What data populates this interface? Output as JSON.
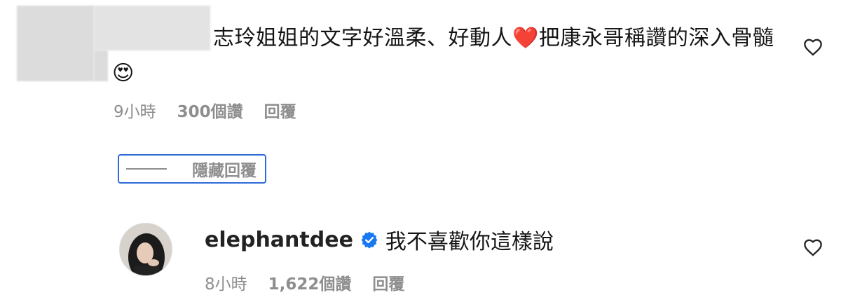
{
  "comment1": {
    "text_part1": "志玲姐姐的文字好溫柔、好動人",
    "heart_emoji": "❤️",
    "text_part2": "把康永哥稱讚的深入骨髓",
    "emoji_end": "😍",
    "time": "9小時",
    "likes": "300個讚",
    "reply": "回覆"
  },
  "replies_toggle": {
    "label": "隱藏回覆"
  },
  "comment2": {
    "username": "elephantdee",
    "text": "我不喜歡你這樣說",
    "time": "8小時",
    "likes": "1,622個讚",
    "reply": "回覆"
  },
  "colors": {
    "verified": "#1877f2",
    "meta_text": "#8e8e8e",
    "focus_outline": "#2f6bd6"
  },
  "icons": {
    "like": "heart-outline-icon",
    "verified": "verified-badge-icon"
  }
}
